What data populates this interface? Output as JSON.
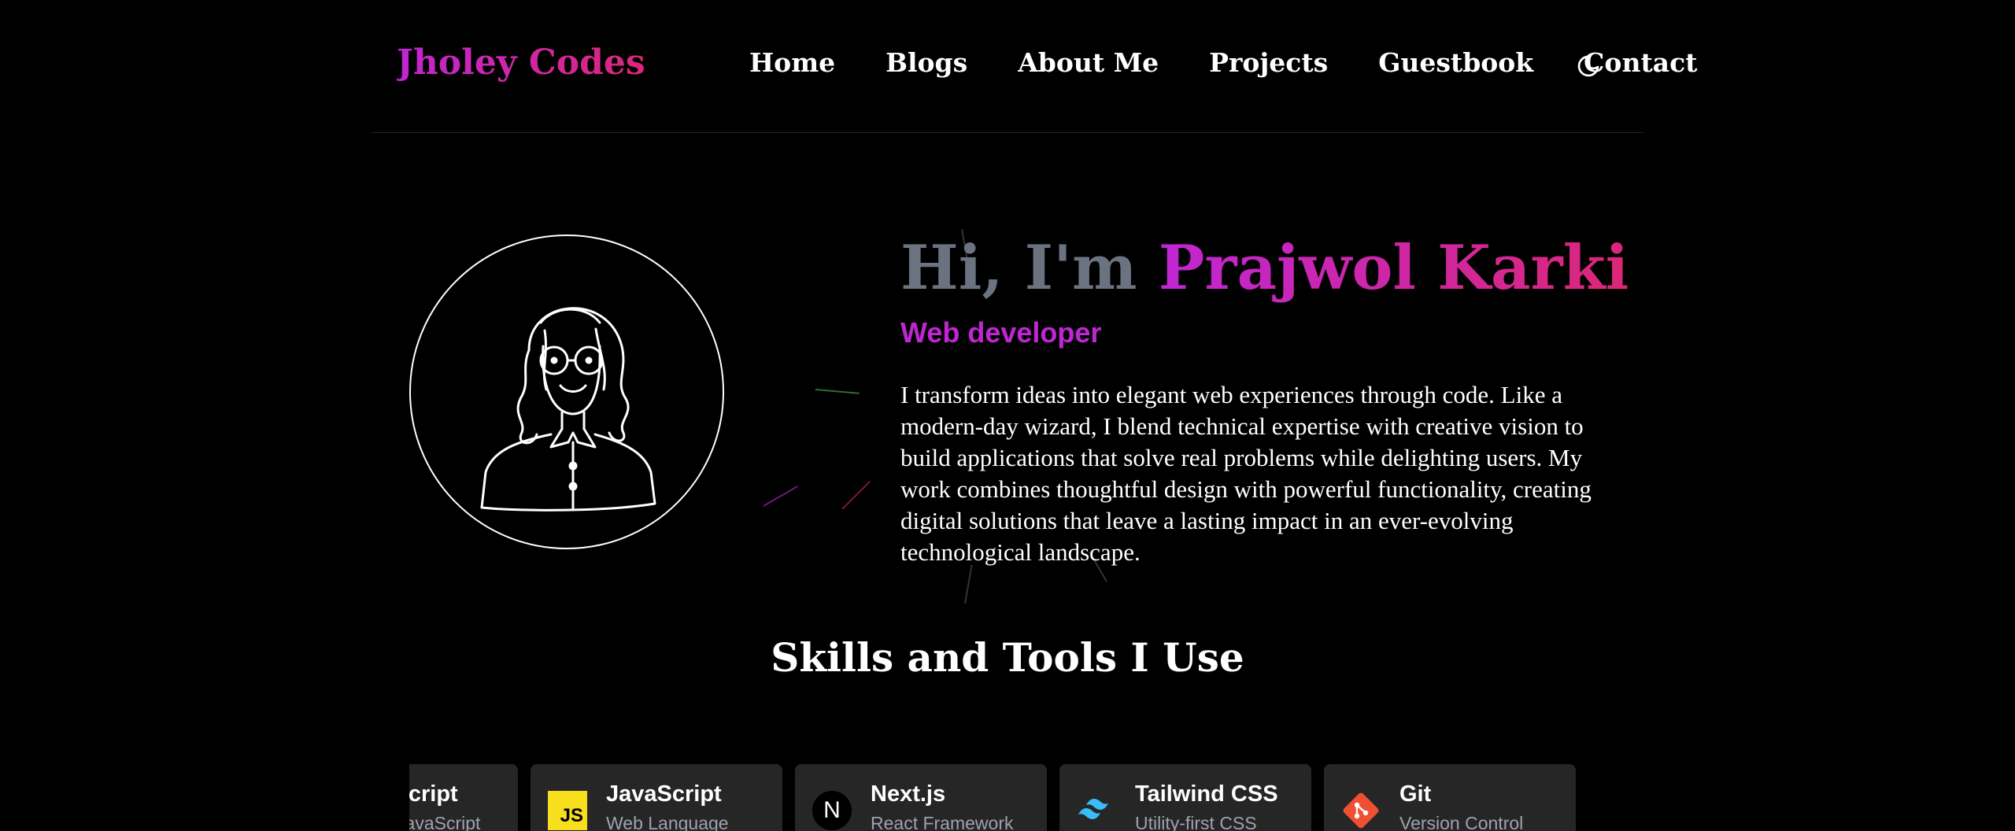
{
  "header": {
    "logo": "Jholey Codes",
    "nav": [
      "Home",
      "Blogs",
      "About Me",
      "Projects",
      "Guestbook",
      "Contact"
    ],
    "theme_icon": "moon-icon"
  },
  "hero": {
    "greeting": "Hi, I'm ",
    "name": "Prajwol Karki",
    "role": "Web developer",
    "description": "I transform ideas into elegant web experiences through code. Like a modern-day wizard, I blend technical expertise with creative vision to build applications that solve real problems while delighting users. My work combines thoughtful design with powerful functionality, creating digital solutions that leave a lasting impact in an ever-evolving technological landscape."
  },
  "skills": {
    "title": "Skills and Tools I Use",
    "items": [
      {
        "name": "TypeScript",
        "sub": "Typed JavaScript",
        "icon": "typescript-icon"
      },
      {
        "name": "JavaScript",
        "sub": "Web Language",
        "icon": "javascript-icon"
      },
      {
        "name": "Next.js",
        "sub": "React Framework",
        "icon": "nextjs-icon"
      },
      {
        "name": "Tailwind CSS",
        "sub": "Utility-first CSS",
        "icon": "tailwind-icon"
      },
      {
        "name": "Git",
        "sub": "Version Control",
        "icon": "git-icon"
      }
    ]
  },
  "colors": {
    "accent_purple": "#c026d3",
    "accent_pink": "#db2777",
    "card_bg": "#262626",
    "tailwind": "#38bdf8",
    "git": "#f05032",
    "js": "#f7df1e"
  }
}
